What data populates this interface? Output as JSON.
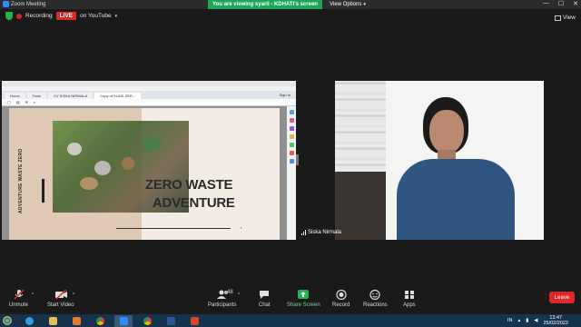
{
  "window": {
    "title": "Zoom Meeting",
    "controls": [
      "—",
      "☐",
      "✕"
    ]
  },
  "topbar": {
    "recording_label": "Recording",
    "live_label": "LIVE",
    "youtube_label": "on YouTube",
    "viewing_banner": "You are viewing syaril - KDHATI's screen",
    "view_options_label": "View Options",
    "view_label": "View"
  },
  "shared_screen": {
    "tabs": [
      {
        "label": "Home"
      },
      {
        "label": "Tools"
      },
      {
        "label": "CV SISKA NIRMALA"
      },
      {
        "label": "Copy of SLIDE ZER..."
      }
    ],
    "sign_in_label": "Sign In",
    "slide": {
      "side_label": "ADVENTURE WASTE ZERO",
      "headline_line1": "ZERO WASTE",
      "headline_line2": "ADVENTURE"
    }
  },
  "speaker": {
    "name": "Siska Nirmala"
  },
  "toolbar": {
    "unmute_label": "Unmute",
    "start_video_label": "Start Video",
    "participants_label": "Participants",
    "participants_count": "48",
    "chat_label": "Chat",
    "share_screen_label": "Share Screen",
    "record_label": "Record",
    "reactions_label": "Reactions",
    "apps_label": "Apps",
    "leave_label": "Leave"
  },
  "taskbar": {
    "time": "13:47",
    "date": "25/02/2022",
    "lang": "IN"
  },
  "colors": {
    "viewing_banner": "#1da55a",
    "live": "#e02828",
    "leave": "#e02828",
    "share_screen": "#22b14c"
  }
}
